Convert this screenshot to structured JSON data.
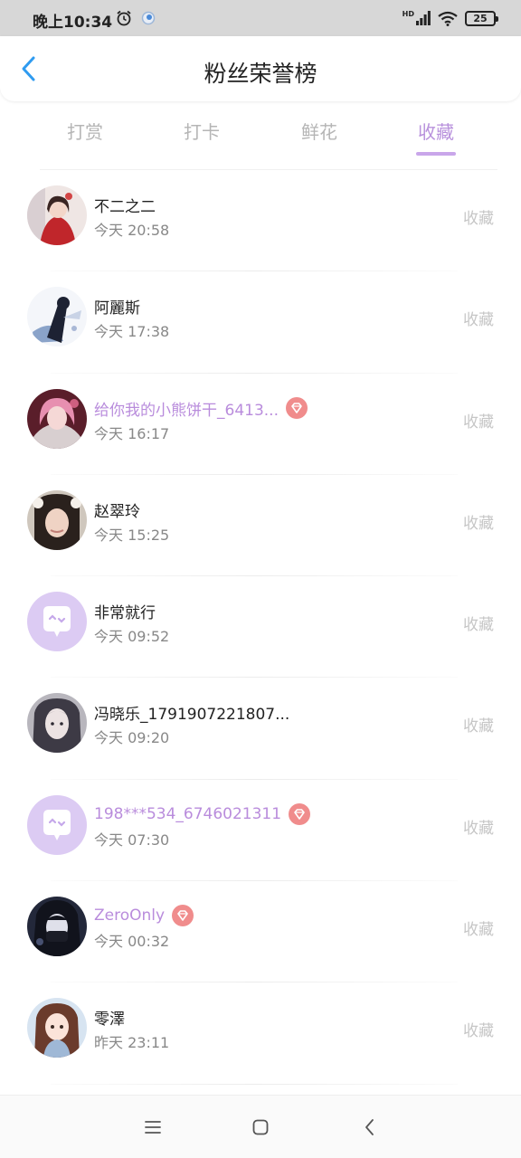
{
  "status_bar": {
    "time": "晚上10:34",
    "network_label": "HD",
    "battery_level": "25"
  },
  "header": {
    "title": "粉丝荣誉榜",
    "back_icon": "chevron-left-icon",
    "accent_color": "#2f9bf0"
  },
  "tabs": [
    {
      "label": "打赏",
      "active": false
    },
    {
      "label": "打卡",
      "active": false
    },
    {
      "label": "鲜花",
      "active": false
    },
    {
      "label": "收藏",
      "active": true
    }
  ],
  "theme": {
    "accent": "#c9a6ea",
    "vip_name_color": "#b98cdc",
    "badge_color": "#f08c8c"
  },
  "list": [
    {
      "name": "不二之二",
      "time": "今天 20:58",
      "action": "收藏",
      "vip": false
    },
    {
      "name": "阿麗斯",
      "time": "今天 17:38",
      "action": "收藏",
      "vip": false
    },
    {
      "name": "给你我的小熊饼干_6413...",
      "time": "今天 16:17",
      "action": "收藏",
      "vip": true
    },
    {
      "name": "赵翠玲",
      "time": "今天 15:25",
      "action": "收藏",
      "vip": false
    },
    {
      "name": "非常就行",
      "time": "今天 09:52",
      "action": "收藏",
      "vip": false
    },
    {
      "name": "冯晓乐_1791907221807...",
      "time": "今天 09:20",
      "action": "收藏",
      "vip": false
    },
    {
      "name": "198***534_6746021311",
      "time": "今天 07:30",
      "action": "收藏",
      "vip": true
    },
    {
      "name": "ZeroOnly",
      "time": "今天 00:32",
      "action": "收藏",
      "vip": true
    },
    {
      "name": "零澤",
      "time": "昨天 23:11",
      "action": "收藏",
      "vip": false
    }
  ],
  "nav_bar": {
    "buttons": [
      "menu-icon",
      "home-icon",
      "back-icon"
    ]
  }
}
